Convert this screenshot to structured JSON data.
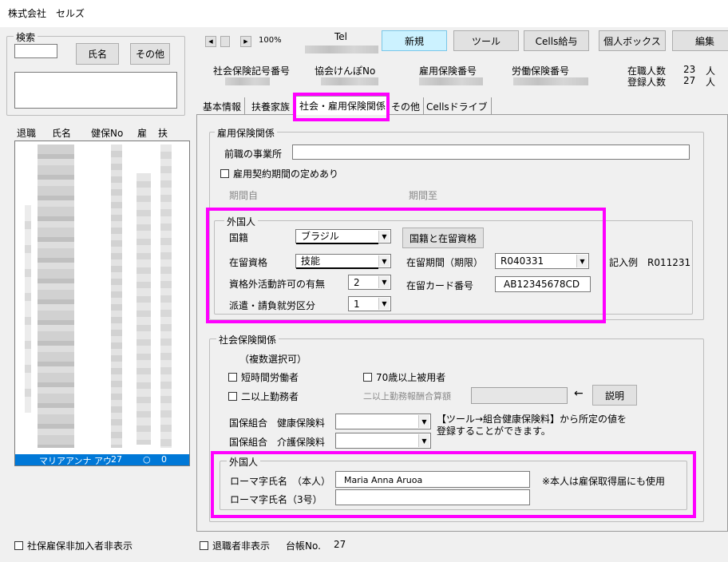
{
  "window": {
    "title": "株式会社　セルズ"
  },
  "search": {
    "legend": "検索",
    "name_button": "氏名",
    "other_button": "その他"
  },
  "employee_list": {
    "headers": [
      "退職",
      "氏名",
      "健保No",
      "雇",
      "扶"
    ],
    "selected_row": {
      "name": "マリアアンナ アウ",
      "health_no": "27",
      "koyo": "○",
      "fuyo": "0"
    }
  },
  "nav": {
    "prev_label": "◀",
    "next_label": "▶",
    "zoom": "100%",
    "tel_label": "Tel"
  },
  "toolbar": {
    "new": "新規",
    "tools": "ツール",
    "cells_salary": "Cells給与",
    "personal_box": "個人ボックス",
    "edit": "編集"
  },
  "header_fields": {
    "social_insurance_no": "社会保険記号番号",
    "kyokai_kenpo_no": "協会けんぽNo",
    "employment_ins_no": "雇用保険番号",
    "labor_ins_no": "労働保険番号",
    "employed_count_label": "在職人数",
    "employed_count": "23",
    "registered_count_label": "登録人数",
    "registered_count": "27",
    "unit": "人"
  },
  "tabs": [
    "基本情報",
    "扶養家族",
    "社会・雇用保険関係",
    "その他",
    "Cellsドライブ"
  ],
  "employment_section": {
    "legend": "雇用保険関係",
    "prev_employer_label": "前職の事業所",
    "prev_employer_value": "",
    "fixed_term_label": "雇用契約期間の定めあり",
    "period_from_label": "期間自",
    "period_to_label": "期間至"
  },
  "foreigner_section": {
    "legend": "外国人",
    "nationality_label": "国籍",
    "nationality_value": "ブラジル",
    "nationality_button": "国籍と在留資格",
    "status_label": "在留資格",
    "status_value": "技能",
    "stay_period_label": "在留期間（期限）",
    "stay_period_value": "R040331",
    "example_text": "記入例　R011231",
    "outside_activity_label": "資格外活動許可の有無",
    "outside_activity_value": "2",
    "card_no_label": "在留カード番号",
    "card_no_value": "AB12345678CD",
    "dispatch_label": "派遣・請負就労区分",
    "dispatch_value": "1"
  },
  "social_section": {
    "legend": "社会保険関係",
    "multi_select_note": "（複数選択可）",
    "short_time_label": "短時間労働者",
    "over70_label": "70歳以上被用者",
    "multi_office_label": "二以上勤務者",
    "multi_office_total_label": "二以上勤務報酬合算額",
    "multi_office_total_value": "",
    "arrow": "←",
    "explain_button": "説明",
    "health_ins_label": "国保組合　健康保険料",
    "care_ins_label": "国保組合　介護保険料",
    "note": "【ツール→組合健康保険料】から所定の値を登録することができます。"
  },
  "foreigner_name_section": {
    "legend": "外国人",
    "roman_name_label": "ローマ字氏名　（本人）",
    "roman_name_value": "Maria Anna Aruoa",
    "roman_name_note": "※本人は雇保取得届にも使用",
    "roman_name3_label": "ローマ字氏名（3号）",
    "roman_name3_value": ""
  },
  "footer": {
    "hide_non_enrolled_label": "社保雇保非加入者非表示",
    "hide_retired_label": "退職者非表示",
    "ledger_no_label": "台帳No.",
    "ledger_no_value": "27"
  },
  "colors": {
    "highlight": "#ff00ff",
    "selected_row": "#0078d7",
    "active_button": "#ccf2ff"
  }
}
